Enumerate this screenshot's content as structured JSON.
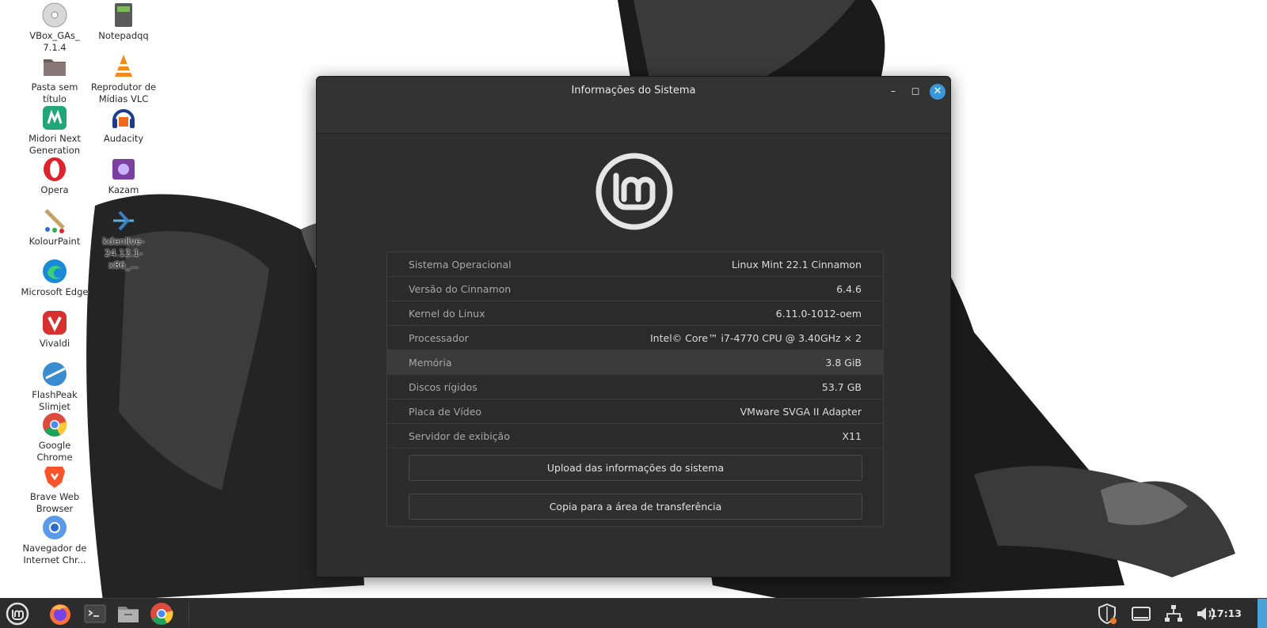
{
  "desktop": {
    "icons": [
      {
        "label": "VBox_GAs_\n7.1.4",
        "icon": "disc-icon"
      },
      {
        "label": "Notepadqq",
        "icon": "notepadqq-icon"
      },
      {
        "label": "Pasta sem título",
        "icon": "folder-icon"
      },
      {
        "label": "Reprodutor de Mídias VLC",
        "icon": "vlc-icon"
      },
      {
        "label": "Midori Next Generation",
        "icon": "midori-icon"
      },
      {
        "label": "Audacity",
        "icon": "audacity-icon"
      },
      {
        "label": "Opera",
        "icon": "opera-icon"
      },
      {
        "label": "Kazam",
        "icon": "kazam-icon"
      },
      {
        "label": "KolourPaint",
        "icon": "kolourpaint-icon"
      },
      {
        "label": "kdenlive-24.12.1-x86_...",
        "icon": "kdenlive-icon"
      },
      {
        "label": "Microsoft Edge",
        "icon": "edge-icon"
      },
      {
        "label": "Vivaldi",
        "icon": "vivaldi-icon"
      },
      {
        "label": "FlashPeak Slimjet",
        "icon": "slimjet-icon"
      },
      {
        "label": "Google Chrome",
        "icon": "chrome-icon"
      },
      {
        "label": "Brave Web Browser",
        "icon": "brave-icon"
      },
      {
        "label": "Navegador de Internet Chr...",
        "icon": "chromium-icon"
      }
    ]
  },
  "window": {
    "title": "Informações do Sistema",
    "rows": [
      {
        "label": "Sistema Operacional",
        "value": "Linux Mint 22.1 Cinnamon"
      },
      {
        "label": "Versão do Cinnamon",
        "value": "6.4.6"
      },
      {
        "label": "Kernel do Linux",
        "value": "6.11.0-1012-oem"
      },
      {
        "label": "Processador",
        "value": "Intel© Core™ i7-4770 CPU @ 3.40GHz × 2"
      },
      {
        "label": "Memória",
        "value": "3.8 GiB"
      },
      {
        "label": "Discos rígidos",
        "value": "53.7 GB"
      },
      {
        "label": "Placa de Vídeo",
        "value": "VMware SVGA II Adapter"
      },
      {
        "label": "Servidor de exibição",
        "value": "X11"
      }
    ],
    "upload_button": "Upload das informações do sistema",
    "copy_button": "Copia para a área de transferência"
  },
  "taskbar": {
    "clock": "17:13",
    "pinned": [
      "mint-menu-icon",
      "firefox-icon",
      "terminal-icon",
      "files-icon",
      "chrome-icon"
    ],
    "tray": [
      "shield-update-icon",
      "display-icon",
      "network-icon",
      "volume-icon"
    ]
  },
  "colors": {
    "window_bg": "#2e2e2e",
    "close_button": "#3a97d8",
    "highlight_row": "#3b3b3b"
  }
}
